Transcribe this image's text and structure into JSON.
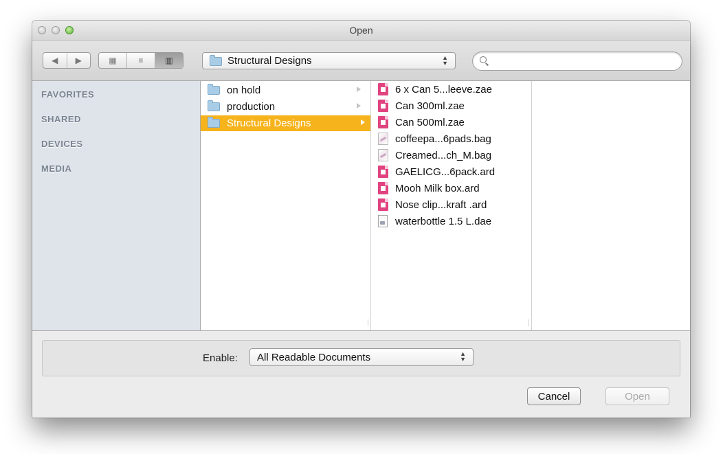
{
  "window": {
    "title": "Open"
  },
  "toolbar": {
    "nav": {
      "back": "◀",
      "forward": "▶"
    },
    "views": {
      "icon": "▦",
      "list": "≡",
      "column": "▥"
    },
    "path_label": "Structural Designs",
    "search_placeholder": "",
    "search_value": ""
  },
  "sidebar": {
    "sections": [
      "FAVORITES",
      "SHARED",
      "DEVICES",
      "MEDIA"
    ]
  },
  "column1": {
    "items": [
      {
        "label": "on hold",
        "selected": false
      },
      {
        "label": "production",
        "selected": false
      },
      {
        "label": "Structural Designs",
        "selected": true
      }
    ]
  },
  "column2": {
    "items": [
      {
        "label": "6 x Can 5...leeve.zae",
        "icon": "zae-doc-icon"
      },
      {
        "label": "Can 300ml.zae",
        "icon": "zae-doc-icon"
      },
      {
        "label": "Can 500ml.zae",
        "icon": "zae-doc-icon"
      },
      {
        "label": "coffeepa...6pads.bag",
        "icon": "bag-doc-icon"
      },
      {
        "label": "Creamed...ch_M.bag",
        "icon": "bag-doc-icon"
      },
      {
        "label": "GAELICG...6pack.ard",
        "icon": "ard-doc-icon"
      },
      {
        "label": "Mooh Milk box.ard",
        "icon": "ard-doc-icon"
      },
      {
        "label": "Nose clip...kraft .ard",
        "icon": "ard-doc-icon"
      },
      {
        "label": "waterbottle 1.5 L.dae",
        "icon": "dae-doc-icon"
      }
    ]
  },
  "bottom": {
    "enable_label": "Enable:",
    "enable_value": "All Readable Documents",
    "cancel_label": "Cancel",
    "open_label": "Open"
  },
  "colors": {
    "selection": "#f6b31c",
    "doc_pink": "#e0437f",
    "sidebar_bg": "#dfe4ea"
  }
}
